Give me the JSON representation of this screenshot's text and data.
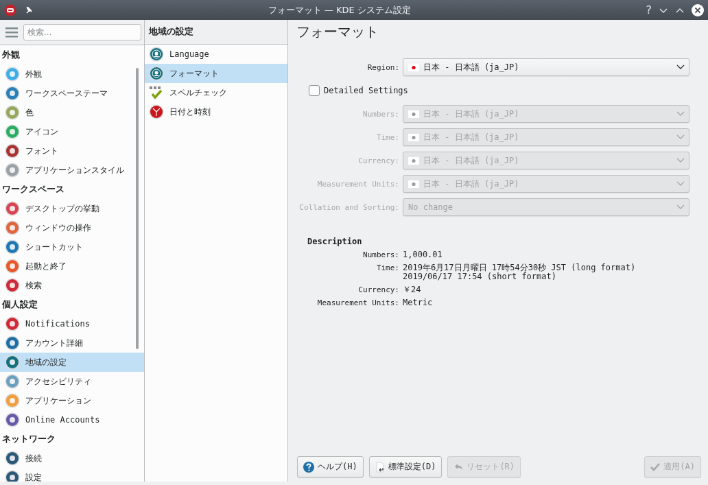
{
  "window": {
    "title": "フォーマット — KDE システム設定",
    "help_glyph": "?"
  },
  "sidebar": {
    "search_placeholder": "検索...",
    "groups": [
      {
        "title": "外観",
        "items": [
          {
            "label": "外観",
            "selected": false,
            "color": "#3daee9"
          },
          {
            "label": "ワークスペーステーマ",
            "selected": false,
            "color": "#2980b9"
          },
          {
            "label": "色",
            "selected": false,
            "color": "#95a85a"
          },
          {
            "label": "アイコン",
            "selected": false,
            "color": "#27ae60"
          },
          {
            "label": "フォント",
            "selected": false,
            "color": "#a93232"
          },
          {
            "label": "アプリケーションスタイル",
            "selected": false,
            "color": "#9aa1a6"
          }
        ]
      },
      {
        "title": "ワークスペース",
        "items": [
          {
            "label": "デスクトップの挙動",
            "selected": false,
            "color": "#da4453"
          },
          {
            "label": "ウィンドウの操作",
            "selected": false,
            "color": "#e0643c"
          },
          {
            "label": "ショートカット",
            "selected": false,
            "color": "#1d78b6"
          },
          {
            "label": "起動と終了",
            "selected": false,
            "color": "#e8572a"
          },
          {
            "label": "検索",
            "selected": false,
            "color": "#d0293a"
          }
        ]
      },
      {
        "title": "個人設定",
        "items": [
          {
            "label": "Notifications",
            "selected": false,
            "color": "#d12a35"
          },
          {
            "label": "アカウント詳細",
            "selected": false,
            "color": "#1d6fa5"
          },
          {
            "label": "地域の設定",
            "selected": true,
            "color": "#17707f"
          },
          {
            "label": "アクセシビリティ",
            "selected": false,
            "color": "#6b9fbf"
          },
          {
            "label": "アプリケーション",
            "selected": false,
            "color": "#f39c3c"
          },
          {
            "label": "Online Accounts",
            "selected": false,
            "color": "#6758a8"
          }
        ]
      },
      {
        "title": "ネットワーク",
        "items": [
          {
            "label": "接続",
            "selected": false,
            "color": "#2c5878"
          },
          {
            "label": "設定",
            "selected": false,
            "color": "#2c5878"
          }
        ]
      }
    ]
  },
  "subpanel": {
    "title": "地域の設定",
    "items": [
      {
        "label": "Language",
        "selected": false,
        "kind": "region"
      },
      {
        "label": "フォーマット",
        "selected": true,
        "kind": "region"
      },
      {
        "label": "スペルチェック",
        "selected": false,
        "kind": "spell"
      },
      {
        "label": "日付と時刻",
        "selected": false,
        "kind": "clock"
      }
    ]
  },
  "page": {
    "title": "フォーマット",
    "fields": [
      {
        "label": "Region:",
        "value": "日本 - 日本語 (ja_JP)",
        "flag": true,
        "disabled": false
      }
    ],
    "detailed_settings": {
      "label": "Detailed Settings",
      "checked": false
    },
    "detail_fields": [
      {
        "label": "Numbers:",
        "value": "日本 - 日本語 (ja_JP)",
        "flag": true,
        "disabled": true
      },
      {
        "label": "Time:",
        "value": "日本 - 日本語 (ja_JP)",
        "flag": true,
        "disabled": true
      },
      {
        "label": "Currency:",
        "value": "日本 - 日本語 (ja_JP)",
        "flag": true,
        "disabled": true
      },
      {
        "label": "Measurement Units:",
        "value": "日本 - 日本語 (ja_JP)",
        "flag": true,
        "disabled": true
      },
      {
        "label": "Collation and Sorting:",
        "value": "No change",
        "disabled": true
      }
    ],
    "description": {
      "title": "Description",
      "rows": [
        {
          "label": "Numbers:",
          "lines": [
            "1,000.01"
          ]
        },
        {
          "label": "Time:",
          "lines": [
            "2019年6月17日月曜日 17時54分30秒 JST (long format)",
            "2019/06/17 17:54 (short format)"
          ]
        },
        {
          "label": "Currency:",
          "lines": [
            "￥24"
          ]
        },
        {
          "label": "Measurement Units:",
          "lines": [
            "Metric"
          ]
        }
      ]
    },
    "buttons": [
      {
        "label": "ヘルプ(H)",
        "kind": "help",
        "disabled": false
      },
      {
        "label": "標準設定(D)",
        "kind": "defaults",
        "disabled": false
      },
      {
        "label": "リセット(R)",
        "kind": "reset",
        "disabled": true
      },
      {
        "label": "適用(A)",
        "kind": "apply",
        "disabled": true
      }
    ]
  }
}
